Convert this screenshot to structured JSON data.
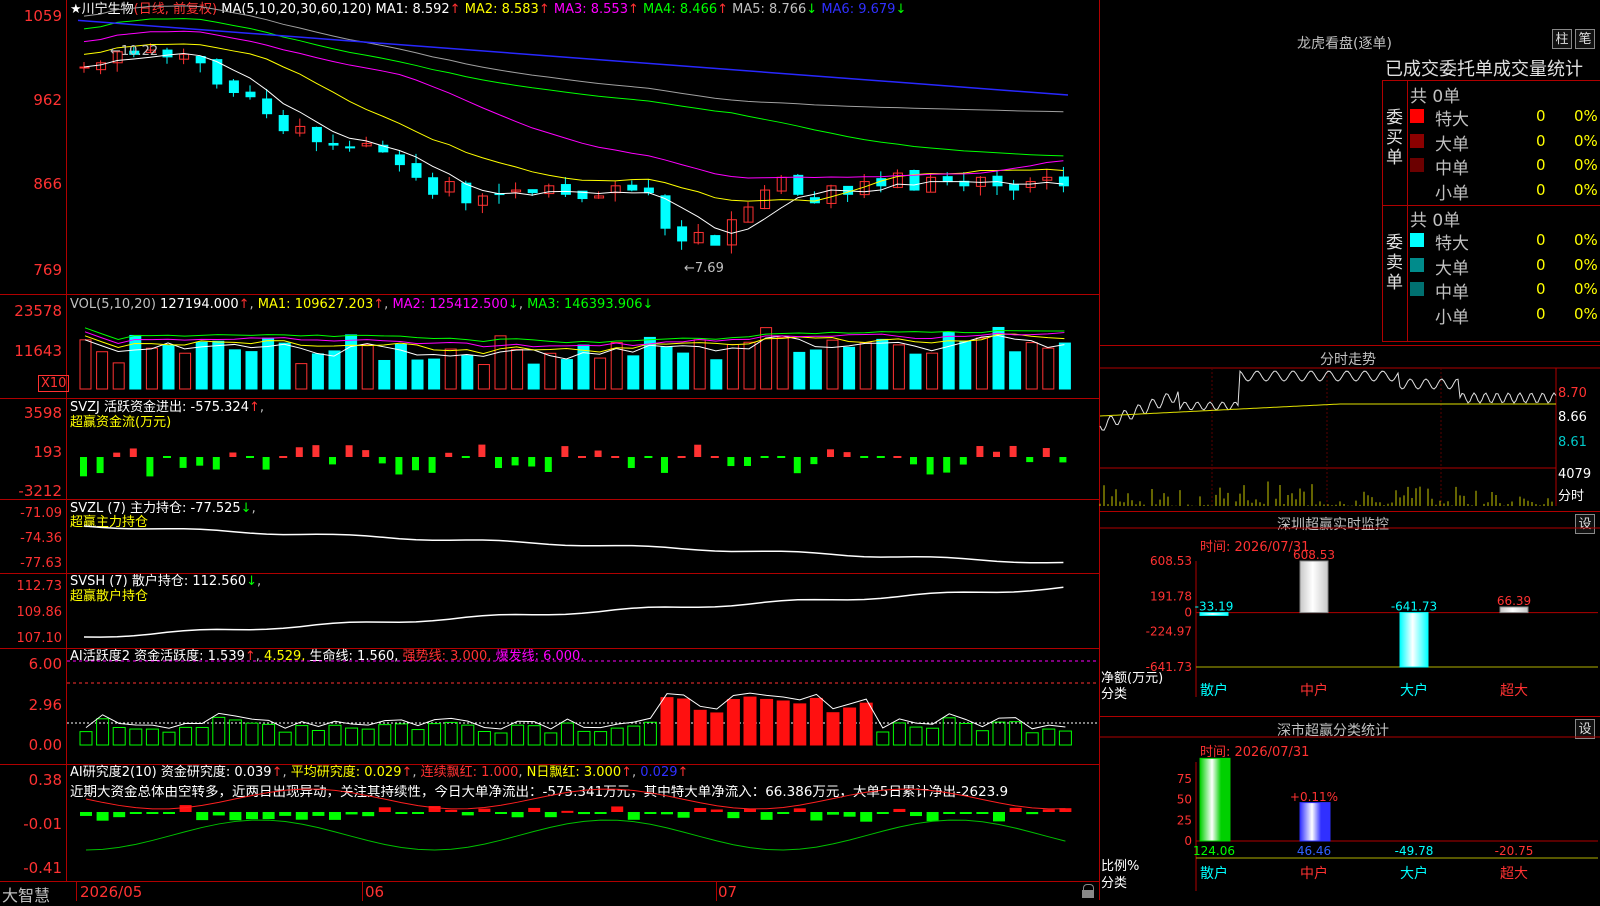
{
  "header": {
    "star": "★",
    "stock_name": "川宁生物",
    "period": "(日线, 前复权)",
    "ma_label": "MA(5,10,20,30,60,120)",
    "ma": [
      {
        "label": "MA1:",
        "value": "8.592",
        "arrow": "↑",
        "color": "#ffffff"
      },
      {
        "label": "MA2:",
        "value": "8.583",
        "arrow": "↑",
        "color": "#ffff00"
      },
      {
        "label": "MA3:",
        "value": "8.553",
        "arrow": "↑",
        "color": "#ff00ff"
      },
      {
        "label": "MA4:",
        "value": "8.466",
        "arrow": "↑",
        "color": "#00ff00"
      },
      {
        "label": "MA5:",
        "value": "8.766",
        "arrow": "↓",
        "color": "#c0c0c0"
      },
      {
        "label": "MA6:",
        "value": "9.679",
        "arrow": "↓",
        "color": "#3030ff"
      }
    ]
  },
  "price_axis": [
    "1059",
    "962",
    "866",
    "769"
  ],
  "price_annotations": {
    "high": "←10.22",
    "low": "←7.69"
  },
  "vol": {
    "label": "VOL(5,10,20)",
    "value": "127194.000",
    "ma1": "MA1: 109627.203",
    "ma2": "MA2: 125412.500",
    "ma3": "MA3: 146393.906",
    "axis": [
      "23578",
      "11643"
    ],
    "unit": "X10"
  },
  "svzj": {
    "label": "SVZJ  活跃资金进出: -575.324",
    "sub": "超赢资金流(万元)",
    "axis": [
      "3598",
      "193",
      "-3212"
    ]
  },
  "svzl": {
    "label": "SVZL (7) 主力持仓: -77.525",
    "sub": "超赢主力持仓",
    "axis": [
      "-71.09",
      "-74.36",
      "-77.63"
    ]
  },
  "svsh": {
    "label": "SVSH (7) 散户持仓: 112.560",
    "sub": "超赢散户持仓",
    "axis": [
      "112.73",
      "109.86",
      "107.10"
    ]
  },
  "ai_active": {
    "label1": "AI活跃度2",
    "label2": "资金活跃度: 1.539",
    "label3": "4.529,",
    "label4": "生命线: 1.560,",
    "label5": "强势线: 3.000,",
    "label6": "爆发线: 6.000,",
    "axis": [
      "6.00",
      "2.96",
      "0.00"
    ]
  },
  "ai_research": {
    "label1": "AI研究度2(10)",
    "label2": "资金研究度: 0.039",
    "label3": "平均研究度: 0.029",
    "label4": "连续飘红: 1.000",
    "label5": "N日飘红: 3.000",
    "label6": "0.029",
    "comment": "近期大资金总体由空转多，近两日出现异动，关注其持续性，今日大单净流出：-575.341万元，其中特大单净流入：66.386万元，大单5日累计净出-2623.9",
    "axis": [
      "0.38",
      "-0.01",
      "-0.41"
    ]
  },
  "bottom": {
    "brand": "大智慧",
    "dates": [
      "2026/05",
      "06",
      "07"
    ]
  },
  "right": {
    "lhb_title": "龙虎看盘(逐单)",
    "btn1": "柱",
    "btn2": "笔",
    "tabs": "已成交委托单成交量统计",
    "buy_title": "委买单",
    "sell_title": "委卖单",
    "buy_total": "共 0单",
    "sell_total": "共 0单",
    "buy_rows": [
      {
        "name": "特大",
        "count": "0",
        "pct": "0%",
        "color": "#ff0000"
      },
      {
        "name": "大单",
        "count": "0",
        "pct": "0%",
        "color": "#8b0000"
      },
      {
        "name": "中单",
        "count": "0",
        "pct": "0%",
        "color": "#6b0000"
      },
      {
        "name": "小单",
        "count": "0",
        "pct": "0%",
        "color": "#000000"
      }
    ],
    "sell_rows": [
      {
        "name": "特大",
        "count": "0",
        "pct": "0%",
        "color": "#00ffff"
      },
      {
        "name": "大单",
        "count": "0",
        "pct": "0%",
        "color": "#008b8b"
      },
      {
        "name": "中单",
        "count": "0",
        "pct": "0%",
        "color": "#007070"
      },
      {
        "name": "小单",
        "count": "0",
        "pct": "0%",
        "color": "#000000"
      }
    ],
    "intraday_title": "分时走势",
    "intraday_axis": [
      "8.70",
      "8.66",
      "8.61",
      "4079"
    ],
    "intraday_unit": "分时",
    "monitor_title": "深圳超赢实时监控",
    "monitor_btn": "设",
    "monitor_time": "时间: 2026/07/31",
    "monitor_axis": [
      "608.53",
      "191.78",
      "0",
      "-224.97",
      "-641.73"
    ],
    "monitor_ylabel": "净额(万元)",
    "monitor_xlabel": "分类",
    "stats_title": "深市超赢分类统计",
    "stats_btn": "设",
    "stats_time": "时间: 2026/07/31",
    "stats_axis": [
      "75",
      "50",
      "25",
      "0"
    ],
    "stats_ylabel": "比例%",
    "stats_xlabel": "分类"
  },
  "chart_data": [
    {
      "type": "bar",
      "title": "深圳超赢实时监控",
      "categories": [
        "散户",
        "中户",
        "大户",
        "超大"
      ],
      "values": [
        -33.19,
        608.53,
        -641.73,
        66.39
      ],
      "ylabel": "净额(万元)",
      "ylim": [
        -641.73,
        608.53
      ]
    },
    {
      "type": "bar",
      "title": "深市超赢分类统计",
      "categories": [
        "散户",
        "中户",
        "大户",
        "超大"
      ],
      "values": [
        124.06,
        46.46,
        -49.78,
        -20.75
      ],
      "annotation": "+0.11%",
      "ylabel": "比例%",
      "ylim": [
        0,
        75
      ]
    }
  ]
}
